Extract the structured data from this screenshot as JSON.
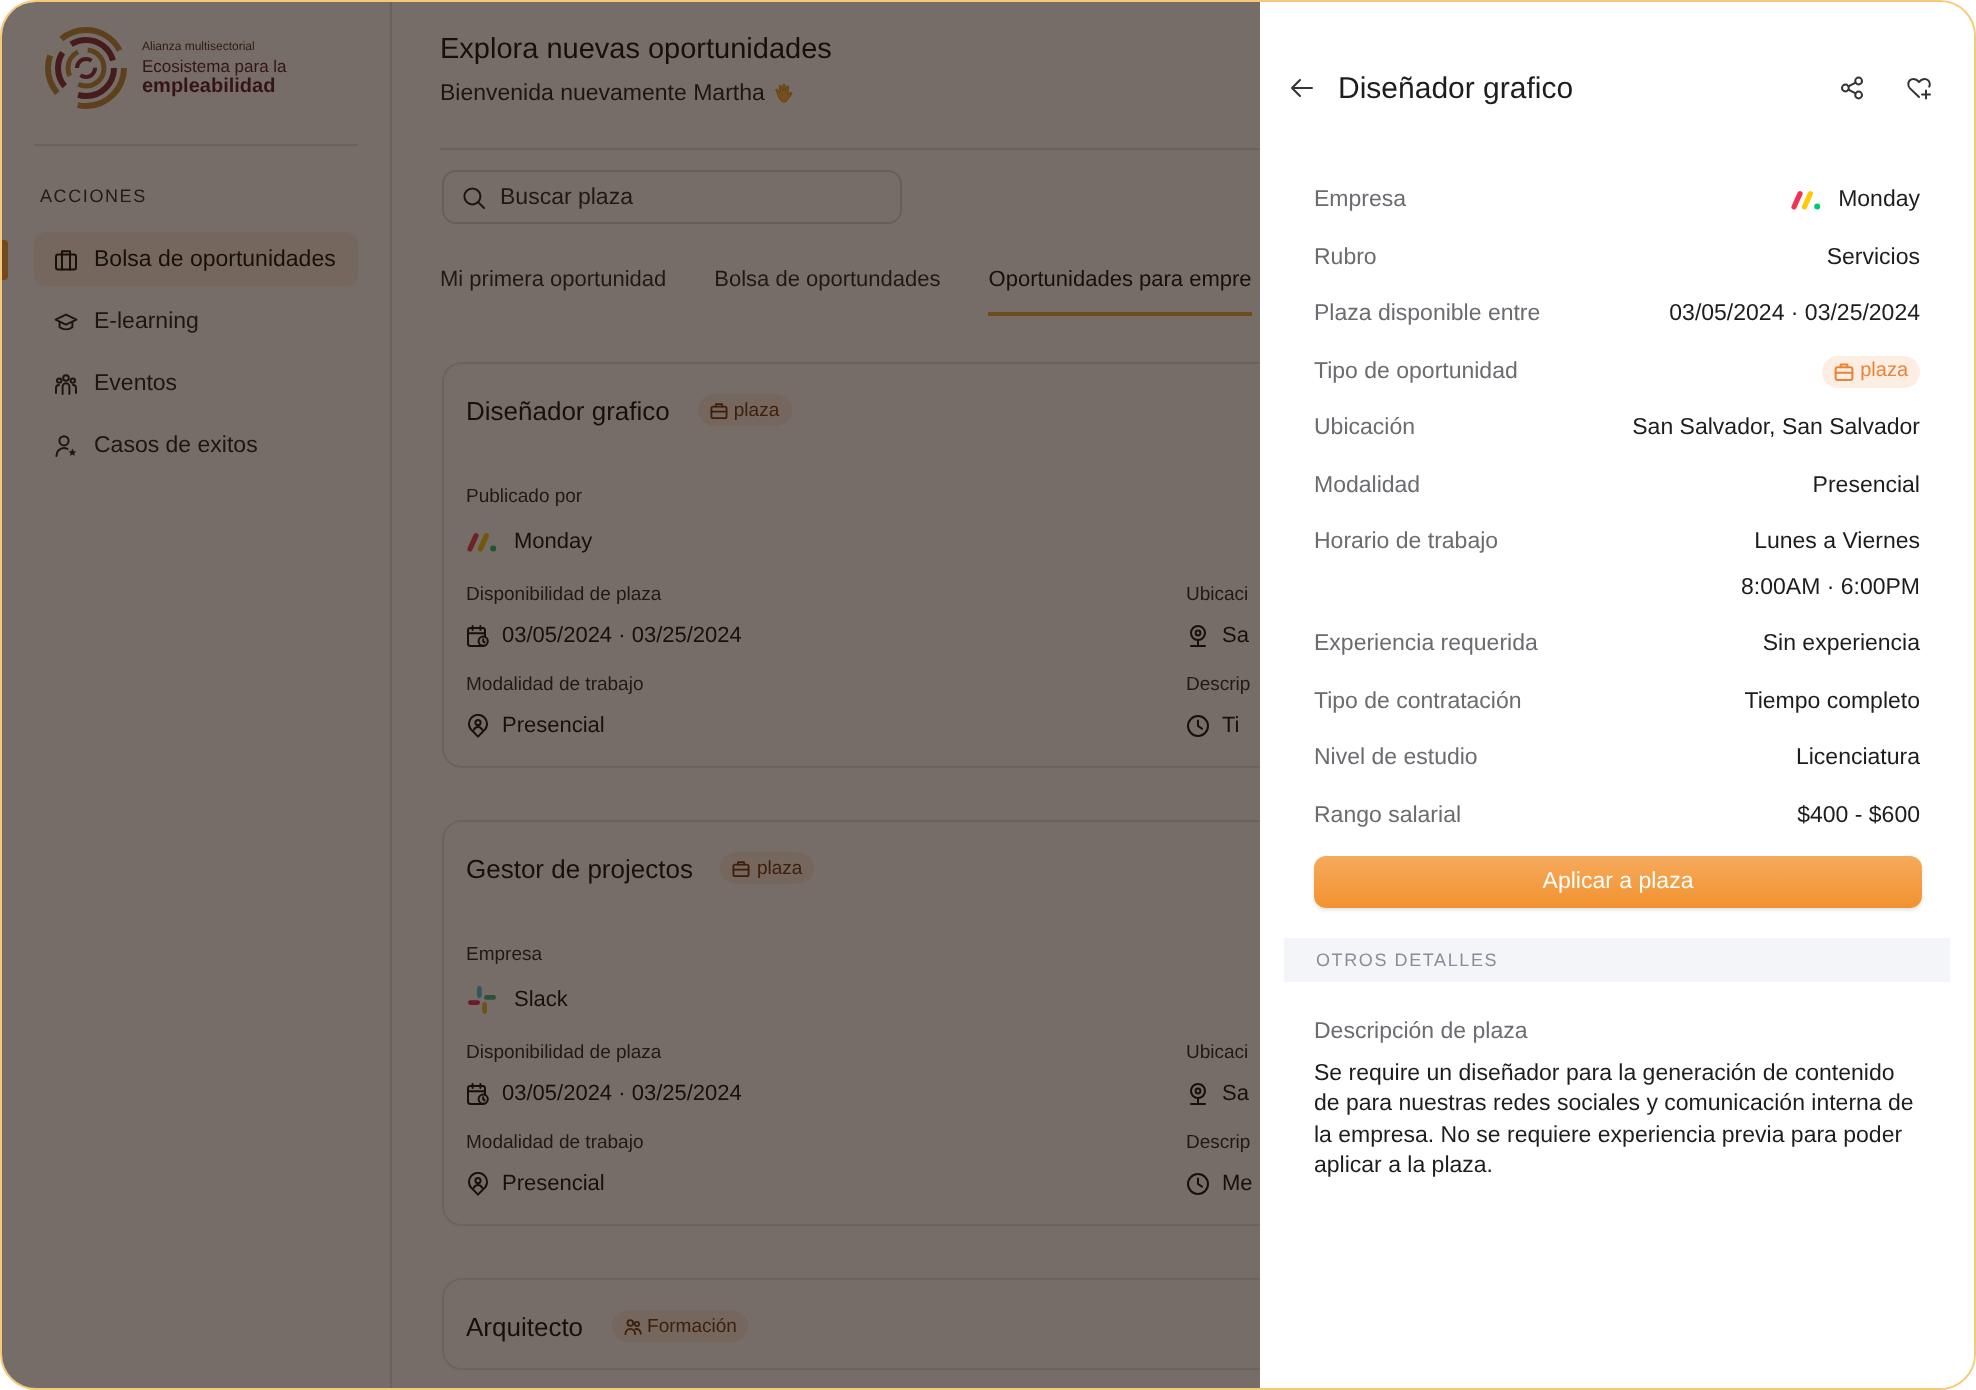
{
  "sidebar": {
    "logo": {
      "tagline": "Alianza multisectorial",
      "title_line_1": "Ecosistema para la",
      "title_line_2": "empleabilidad"
    },
    "section_label": "ACCIONES",
    "items": [
      {
        "label": "Bolsa de oportunidades",
        "selected": true
      },
      {
        "label": "E-learning",
        "selected": false
      },
      {
        "label": "Eventos",
        "selected": false
      },
      {
        "label": "Casos de exitos",
        "selected": false
      }
    ]
  },
  "main": {
    "title": "Explora nuevas oportunidades",
    "greeting": "Bienvenida nuevamente Martha",
    "search": {
      "placeholder": "Buscar plaza"
    },
    "tabs": [
      {
        "label": "Mi primera oportunidad",
        "selected": false
      },
      {
        "label": "Bolsa de oportundades",
        "selected": false
      },
      {
        "label": "Oportunidades para empre",
        "selected": true
      }
    ],
    "cards": [
      {
        "title": "Diseñador grafico",
        "badge": "plaza",
        "company": {
          "label": "Publicado por",
          "value": "Monday"
        },
        "details": [
          {
            "label": "Disponibilidad de plaza",
            "value": "03/05/2024 · 03/25/2024"
          },
          {
            "label": "Ubicaci",
            "value": "Sa"
          },
          {
            "label": "Modalidad de trabajo",
            "value": "Presencial"
          },
          {
            "label": "Descrip",
            "value": "Ti"
          }
        ]
      },
      {
        "title": "Gestor de projectos",
        "badge": "plaza",
        "company": {
          "label": "Empresa",
          "value": "Slack"
        },
        "details": [
          {
            "label": "Disponibilidad de plaza",
            "value": "03/05/2024 · 03/25/2024"
          },
          {
            "label": "Ubicaci",
            "value": "Sa"
          },
          {
            "label": "Modalidad de trabajo",
            "value": "Presencial"
          },
          {
            "label": "Descrip",
            "value": "Me"
          }
        ]
      },
      {
        "title": "Arquitecto",
        "badge": "Formación"
      }
    ]
  },
  "detail_panel": {
    "title": "Diseñador grafico",
    "fields": [
      {
        "kind": "company",
        "label": "Empresa",
        "value": "Monday"
      },
      {
        "kind": "text",
        "label": "Rubro",
        "value": "Servicios"
      },
      {
        "kind": "text",
        "label": "Plaza disponible entre",
        "value": "03/05/2024 · 03/25/2024"
      },
      {
        "kind": "badge",
        "label": "Tipo de oportunidad",
        "value": "plaza"
      },
      {
        "kind": "text",
        "label": "Ubicación",
        "value": "San Salvador, San Salvador"
      },
      {
        "kind": "text",
        "label": "Modalidad",
        "value": "Presencial"
      },
      {
        "kind": "multiline",
        "label": "Horario de trabajo",
        "values": [
          "Lunes a Viernes",
          "8:00AM · 6:00PM"
        ]
      },
      {
        "kind": "text",
        "label": "Experiencia requerida",
        "value": "Sin experiencia"
      },
      {
        "kind": "text",
        "label": "Tipo de contratación",
        "value": "Tiempo completo"
      },
      {
        "kind": "text",
        "label": "Nivel de estudio",
        "value": "Licenciatura"
      },
      {
        "kind": "text",
        "label": "Rango salarial",
        "value": "$400 - $600"
      }
    ],
    "apply_button": "Aplicar a plaza",
    "section_heading": "OTROS DETALLES",
    "description_label": "Descripción de plaza",
    "description": "Se require un diseñador para la generación de contenido de para nuestras redes sociales y comunicación interna de la empresa. No se requiere experiencia previa para poder aplicar a la plaza."
  }
}
